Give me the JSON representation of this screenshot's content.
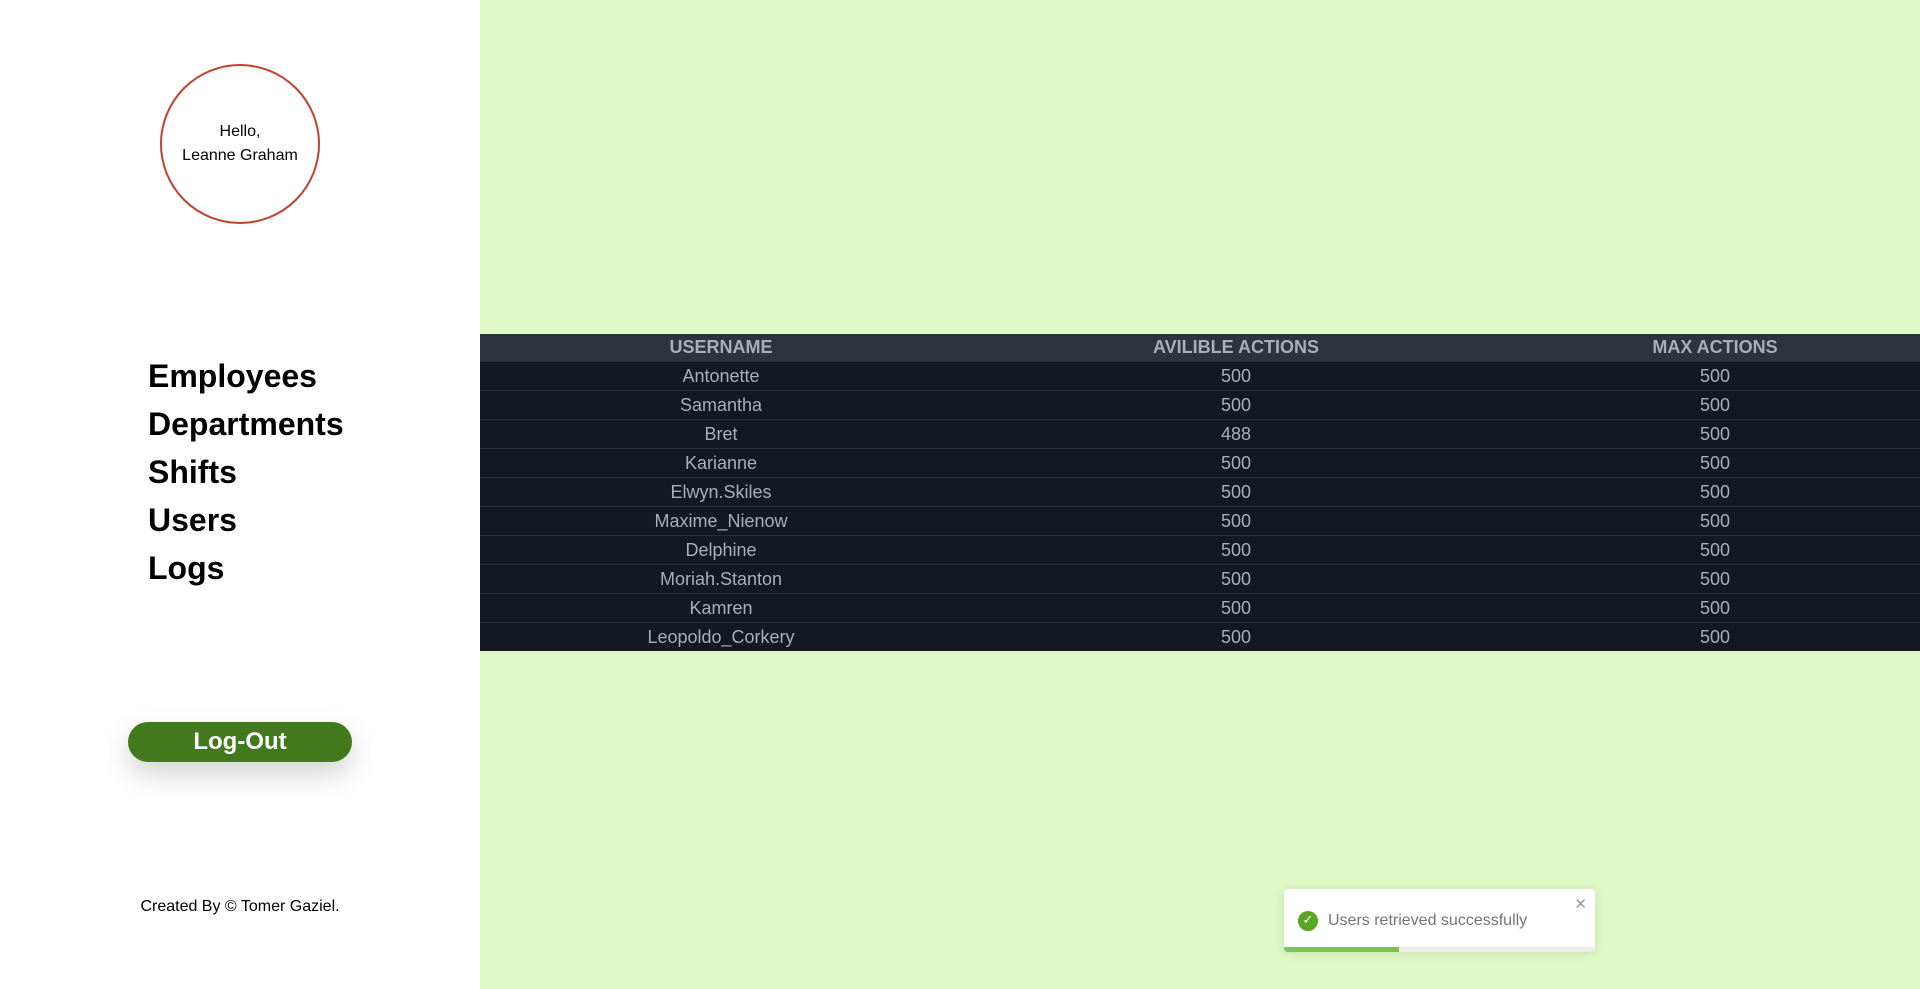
{
  "sidebar": {
    "greeting_line1": "Hello,",
    "greeting_line2": "Leanne Graham",
    "nav_items": [
      "Employees",
      "Departments",
      "Shifts",
      "Users",
      "Logs"
    ],
    "logout_label": "Log-Out",
    "credit": "Created By © Tomer Gaziel."
  },
  "table": {
    "headers": [
      "USERNAME",
      "AVILIBLE ACTIONS",
      "MAX ACTIONS"
    ],
    "rows": [
      [
        "Antonette",
        "500",
        "500"
      ],
      [
        "Samantha",
        "500",
        "500"
      ],
      [
        "Bret",
        "488",
        "500"
      ],
      [
        "Karianne",
        "500",
        "500"
      ],
      [
        "Elwyn.Skiles",
        "500",
        "500"
      ],
      [
        "Maxime_Nienow",
        "500",
        "500"
      ],
      [
        "Delphine",
        "500",
        "500"
      ],
      [
        "Moriah.Stanton",
        "500",
        "500"
      ],
      [
        "Kamren",
        "500",
        "500"
      ],
      [
        "Leopoldo_Corkery",
        "500",
        "500"
      ]
    ]
  },
  "toast": {
    "message": "Users retrieved successfully",
    "icon": "check-circle-icon",
    "close_icon": "close-icon",
    "progress": 0.37
  },
  "colors": {
    "main_background": "#dffac6",
    "accent": "#43791d",
    "circle_border": "#c0432f",
    "table_header": "#2f333e",
    "table_body": "#141823"
  }
}
